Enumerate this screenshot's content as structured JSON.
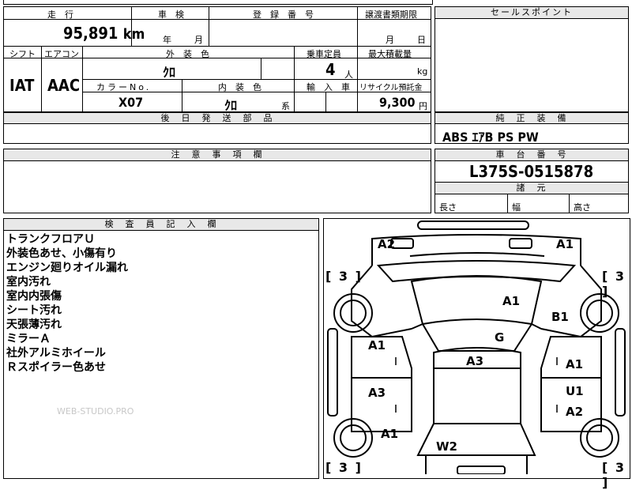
{
  "headers": {
    "mileage": "走　行",
    "inspection": "車　検",
    "registration": "登　録　番　号",
    "transfer_deadline": "譲渡書類期限",
    "sales_point": "セールスポイント",
    "shift": "シフト",
    "aircon": "エアコン",
    "exterior_color": "外　装　色",
    "capacity": "乗車定員",
    "max_load": "最大積載量",
    "color_no": "カラーNo.",
    "interior_color": "内　装　色",
    "import": "輸　入　車",
    "recycle": "リサイクル預託金",
    "later_parts": "後　日　発　送　部　品",
    "equipment": "純　正　装　備",
    "caution": "注　意　事　項　欄",
    "chassis_no": "車　台　番　号",
    "dimensions": "諸　元",
    "inspector_notes": "検　査　員　記　入　欄"
  },
  "values": {
    "mileage": "95,891",
    "mileage_unit": "km",
    "year_label": "年",
    "month_label": "月",
    "deadline_month": "月",
    "deadline_day": "日",
    "shift": "IAT",
    "aircon": "AAC",
    "exterior_color": "ｸﾛ",
    "capacity": "4",
    "capacity_unit": "人",
    "max_load_unit": "kg",
    "color_no": "X07",
    "interior_color": "ｸﾛ",
    "interior_suffix": "系",
    "recycle": "9,300",
    "recycle_unit": "円",
    "equipment": "ABS ｴｱB PS PW",
    "chassis_no": "L375S-0515878",
    "length": "長さ",
    "width": "幅",
    "height": "高さ"
  },
  "notes": [
    "トランクフロアＵ",
    "外装色あせ、小傷有り",
    "エンジン廻りオイル漏れ",
    "室内汚れ",
    "室内内張傷",
    "シート汚れ",
    "天張薄汚れ",
    "ミラーＡ",
    "社外アルミホイール",
    "Ｒスポイラー色あせ"
  ],
  "watermark": "WEB-STUDIO.PRO",
  "diagram": {
    "marks": {
      "a2_top": "A2",
      "a1_top": "A1",
      "a1_hood": "A1",
      "b1": "B1",
      "g": "G",
      "a1_left_door": "A1",
      "a3_roof": "A3",
      "a1_right_door": "A1",
      "a3_left_rear": "A3",
      "u1": "U1",
      "a2_right_rear": "A2",
      "a1_left_bottom": "A1",
      "w2": "W2"
    },
    "tire_tl": "3",
    "tire_tr": "3",
    "tire_bl": "3",
    "tire_br": "3"
  }
}
